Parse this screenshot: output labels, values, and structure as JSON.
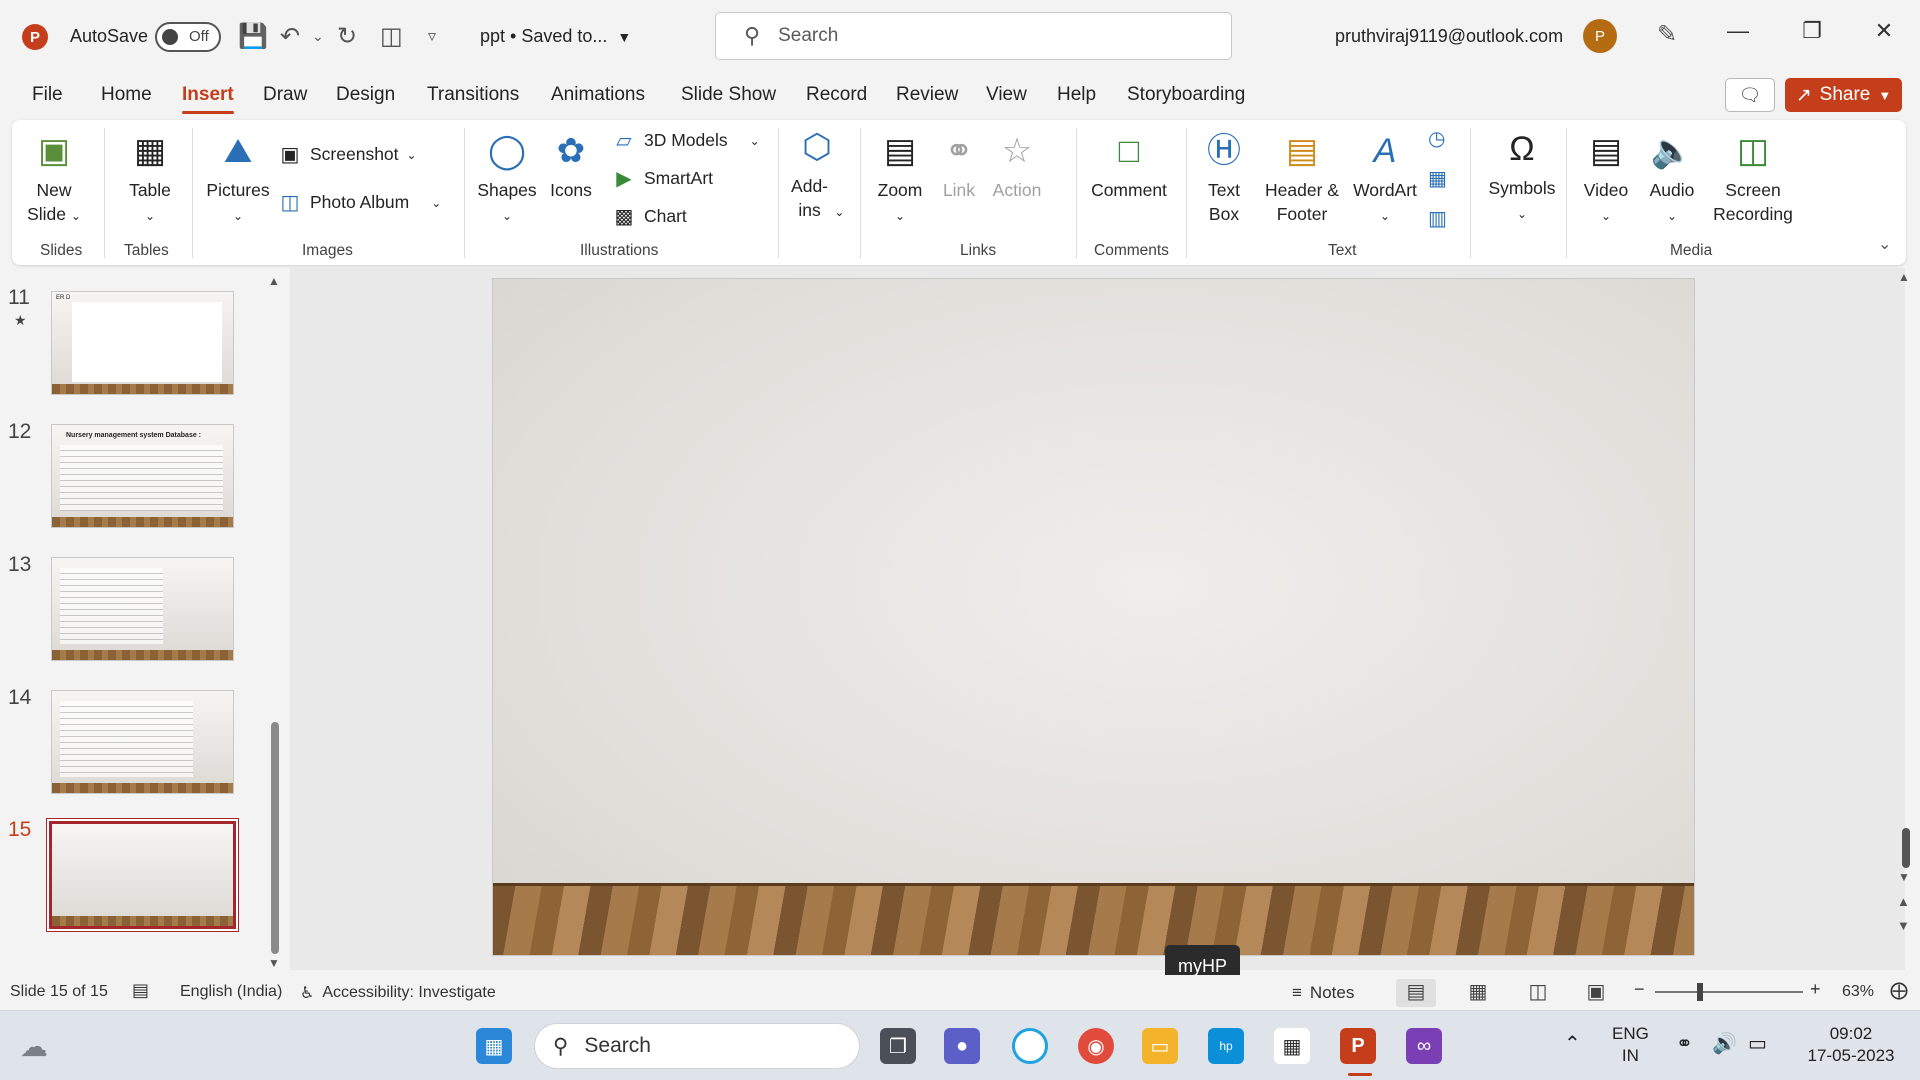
{
  "titlebar": {
    "app_logo": "P",
    "autosave_label": "AutoSave",
    "autosave_state": "Off",
    "doc_title": "ppt • Saved to...",
    "search_placeholder": "Search",
    "account_email": "pruthviraj9119@outlook.com",
    "avatar_initial": "P"
  },
  "menu": {
    "tabs": [
      "File",
      "Home",
      "Insert",
      "Draw",
      "Design",
      "Transitions",
      "Animations",
      "Slide Show",
      "Record",
      "Review",
      "View",
      "Help",
      "Storyboarding"
    ],
    "active": "Insert",
    "share_label": "Share"
  },
  "ribbon": {
    "new_slide": "New Slide",
    "table": "Table",
    "pictures": "Pictures",
    "screenshot": "Screenshot",
    "photo_album": "Photo Album",
    "shapes": "Shapes",
    "icons": "Icons",
    "models3d": "3D Models",
    "smartart": "SmartArt",
    "chart": "Chart",
    "addins": "Add-ins",
    "zoom": "Zoom",
    "link": "Link",
    "action": "Action",
    "comment": "Comment",
    "textbox": "Text Box",
    "header_footer": "Header & Footer",
    "wordart": "WordArt",
    "symbols": "Symbols",
    "video": "Video",
    "audio": "Audio",
    "screen_recording": "Screen Recording",
    "groups": {
      "slides": "Slides",
      "tables": "Tables",
      "images": "Images",
      "illustrations": "Illustrations",
      "links": "Links",
      "comments": "Comments",
      "text": "Text",
      "media": "Media"
    }
  },
  "thumbnails": [
    {
      "num": "11",
      "title": "ER D"
    },
    {
      "num": "12",
      "title": "Nursery management system Database :"
    },
    {
      "num": "13",
      "title": ""
    },
    {
      "num": "14",
      "title": ""
    },
    {
      "num": "15",
      "title": ""
    }
  ],
  "selected_slide": "15",
  "tooltip": "myHP",
  "statusbar": {
    "slide_info": "Slide 15 of 15",
    "language": "English (India)",
    "accessibility": "Accessibility: Investigate",
    "notes": "Notes",
    "zoom": "63%"
  },
  "taskbar": {
    "search": "Search",
    "lang_top": "ENG",
    "lang_bottom": "IN",
    "time": "09:02",
    "date": "17-05-2023"
  },
  "colors": {
    "accent": "#c43e1c",
    "selected_border": "#a4262c"
  }
}
